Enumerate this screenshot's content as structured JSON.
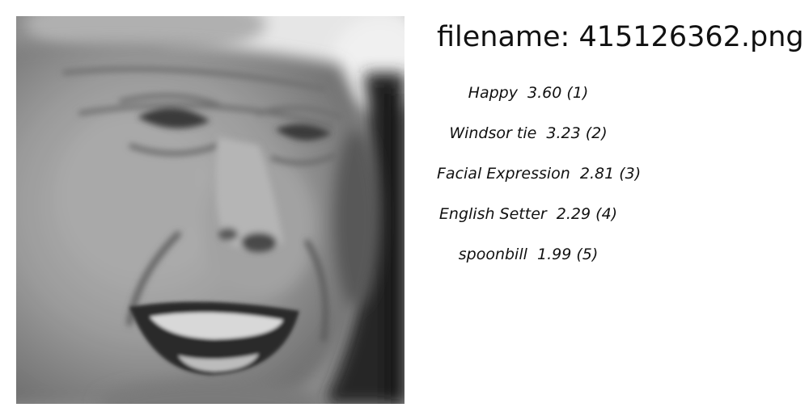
{
  "filename_label": "filename: 415126362.png",
  "photo": {
    "icon": "face-photo",
    "tone": "grayscale"
  },
  "predictions": [
    {
      "label": "Happy",
      "score": "3.60",
      "rank": "(1)"
    },
    {
      "label": "Windsor tie",
      "score": "3.23",
      "rank": "(2)"
    },
    {
      "label": "Facial Expression",
      "score": "2.81",
      "rank": "(3)"
    },
    {
      "label": "English Setter",
      "score": "2.29",
      "rank": "(4)"
    },
    {
      "label": "spoonbill",
      "score": "1.99",
      "rank": "(5)"
    }
  ]
}
